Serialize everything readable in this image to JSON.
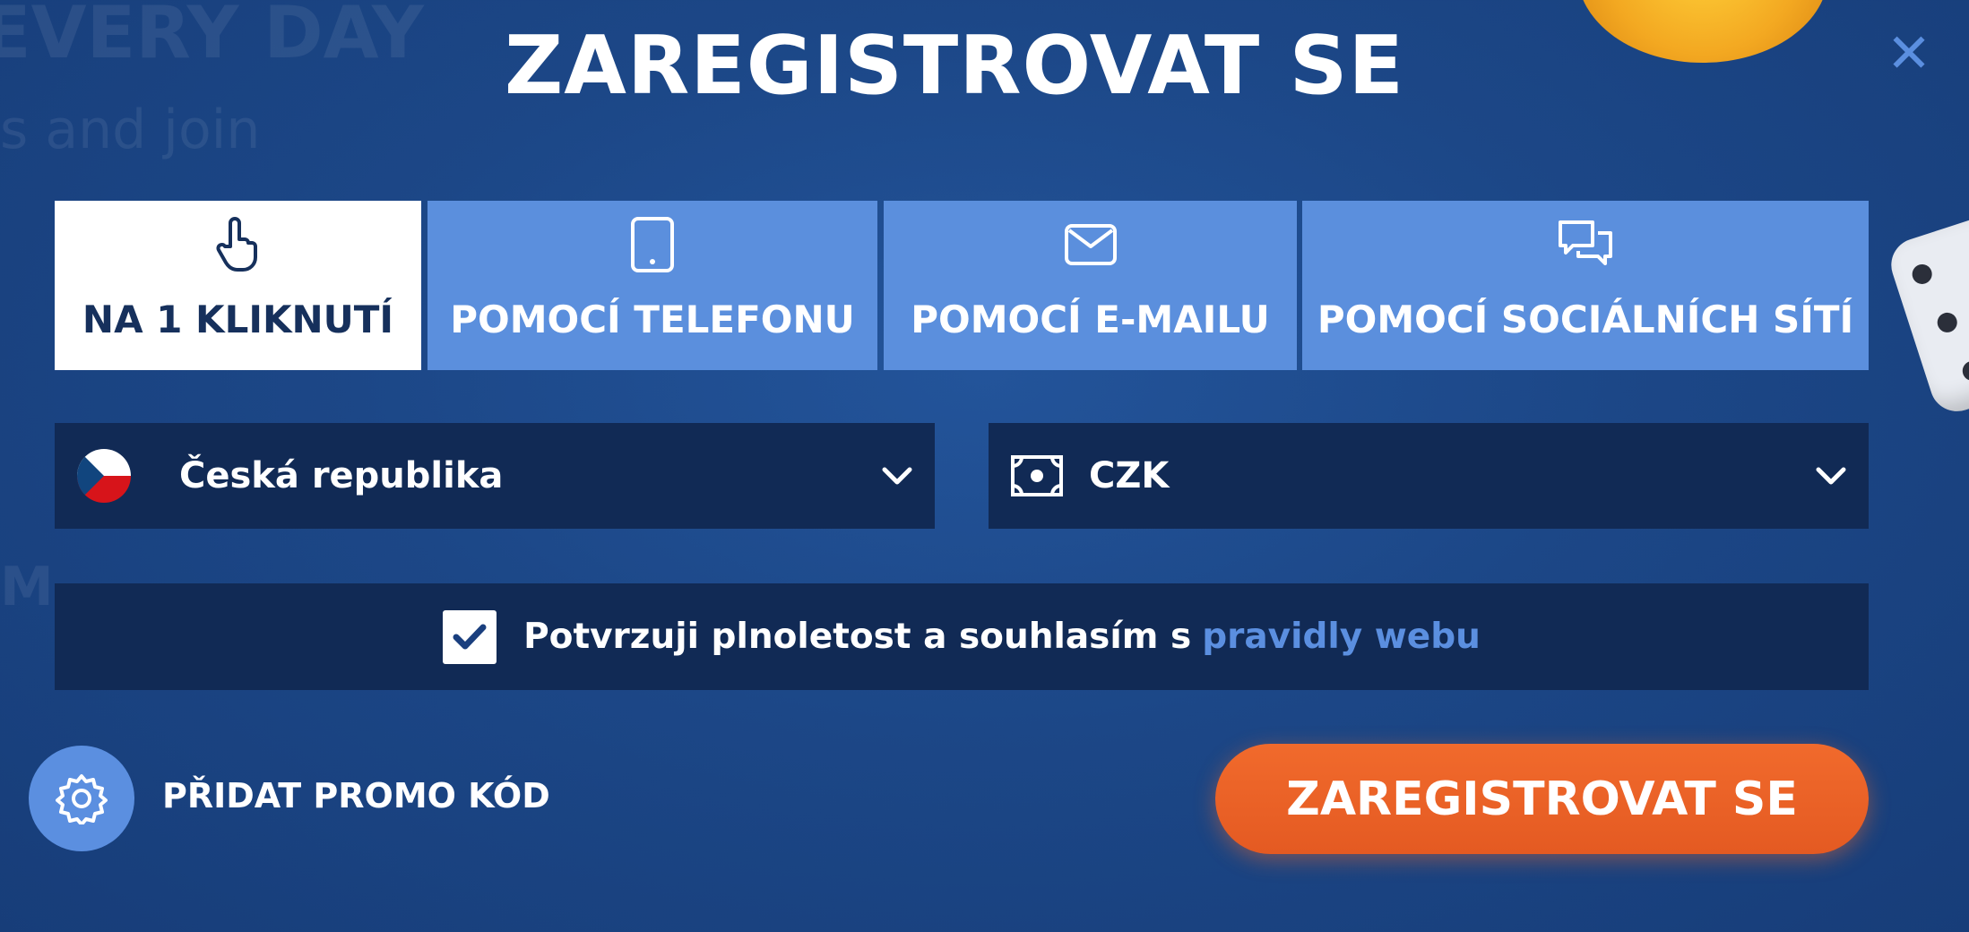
{
  "background": {
    "text_top": "EVERY DAY",
    "text_mid": "s and join",
    "text_low": "M"
  },
  "modal": {
    "title": "ZAREGISTROVAT SE",
    "close_icon": "close-icon"
  },
  "tabs": [
    {
      "label": "NA 1 KLIKNUTÍ",
      "icon": "pointer-hand-icon",
      "active": true
    },
    {
      "label": "POMOCÍ TELEFONU",
      "icon": "phone-icon",
      "active": false
    },
    {
      "label": "POMOCÍ E-MAILU",
      "icon": "envelope-icon",
      "active": false
    },
    {
      "label": "POMOCÍ SOCIÁLNÍCH SÍTÍ",
      "icon": "chat-bubbles-icon",
      "active": false
    }
  ],
  "country_select": {
    "value": "Česká republika",
    "icon": "czech-flag-icon"
  },
  "currency_select": {
    "value": "CZK",
    "icon": "banknote-icon"
  },
  "consent": {
    "checked": true,
    "text": "Potvrzuji plnoletost a souhlasím s",
    "link": "pravidly webu"
  },
  "promo": {
    "label": "PŘIDAT PROMO KÓD",
    "icon": "gear-icon"
  },
  "submit": {
    "label": "ZAREGISTROVAT SE"
  },
  "colors": {
    "background": "#1c4787",
    "tab_inactive": "#5b8fdd",
    "tab_active": "#ffffff",
    "field": "#112a55",
    "accent_link": "#5b8fe0",
    "submit": "#f16a2c"
  }
}
